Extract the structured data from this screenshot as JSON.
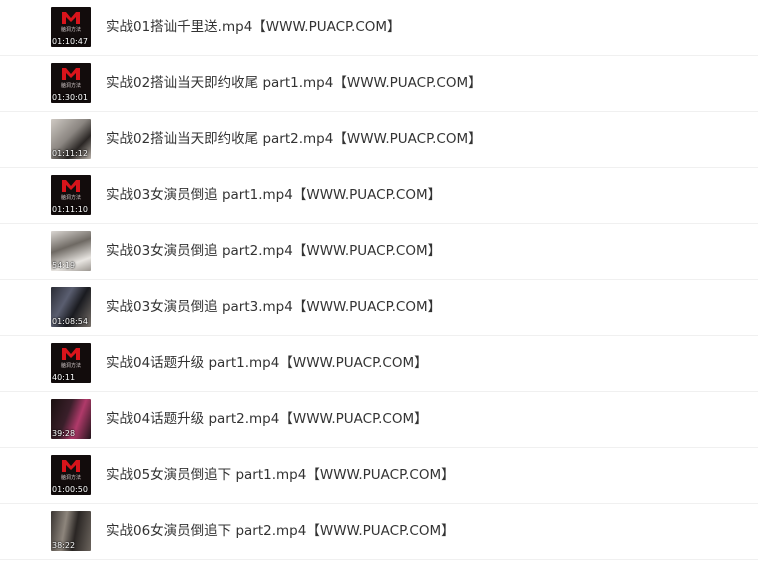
{
  "files": [
    {
      "name": "实战01搭讪千里送.mp4【WWW.PUACP.COM】",
      "duration": "01:10:47",
      "thumb_icon": "brand-logo-icon",
      "brand": "脑洞方法"
    },
    {
      "name": "实战02搭讪当天即约收尾 part1.mp4【WWW.PUACP.COM】",
      "duration": "01:30:01",
      "thumb_icon": "brand-logo-icon",
      "brand": "脑洞方法"
    },
    {
      "name": "实战02搭讪当天即约收尾 part2.mp4【WWW.PUACP.COM】",
      "duration": "01:11:12",
      "thumb_icon": "video-frame-thumbnail"
    },
    {
      "name": "实战03女演员倒追 part1.mp4【WWW.PUACP.COM】",
      "duration": "01:11:10",
      "thumb_icon": "brand-logo-icon",
      "brand": "脑洞方法"
    },
    {
      "name": "实战03女演员倒追 part2.mp4【WWW.PUACP.COM】",
      "duration": "54:19",
      "thumb_icon": "video-frame-thumbnail"
    },
    {
      "name": "实战03女演员倒追 part3.mp4【WWW.PUACP.COM】",
      "duration": "01:08:54",
      "thumb_icon": "video-frame-thumbnail"
    },
    {
      "name": "实战04话题升级 part1.mp4【WWW.PUACP.COM】",
      "duration": "40:11",
      "thumb_icon": "brand-logo-icon",
      "brand": "脑洞方法"
    },
    {
      "name": "实战04话题升级 part2.mp4【WWW.PUACP.COM】",
      "duration": "39:28",
      "thumb_icon": "video-frame-thumbnail"
    },
    {
      "name": "实战05女演员倒追下 part1.mp4【WWW.PUACP.COM】",
      "duration": "01:00:50",
      "thumb_icon": "brand-logo-icon",
      "brand": "脑洞方法"
    },
    {
      "name": "实战06女演员倒追下 part2.mp4【WWW.PUACP.COM】",
      "duration": "38:22",
      "thumb_icon": "video-frame-thumbnail"
    }
  ],
  "colors": {
    "text": "#333333",
    "divider": "#f0f0f0",
    "logo_red": "#d9141b"
  }
}
